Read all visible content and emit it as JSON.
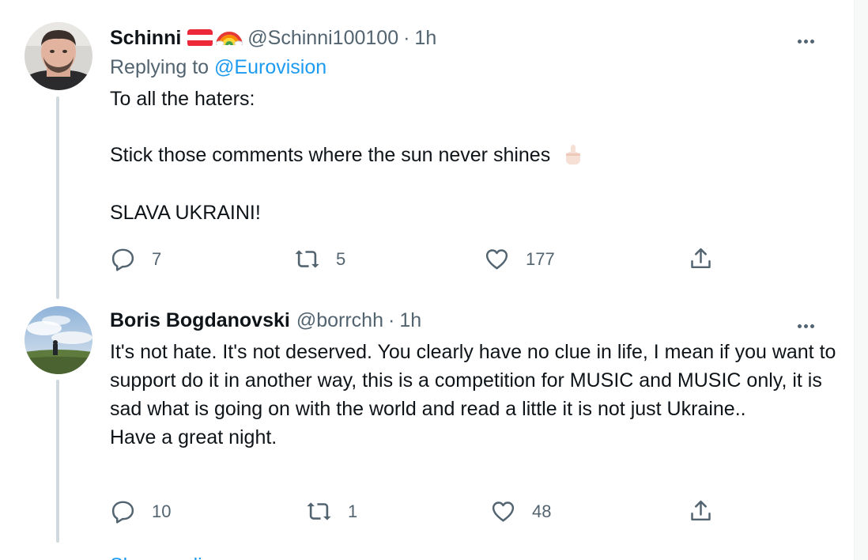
{
  "tweets": [
    {
      "display_name": "Schinni",
      "handle": "@Schinni100100",
      "time": "1h",
      "replying_prefix": "Replying to",
      "replying_to": "@Eurovision",
      "lines": [
        "To all the haters:",
        "Stick those comments where the sun never shines",
        "SLAVA UKRAINI!"
      ],
      "emoji": [
        "flag-austria",
        "rainbow",
        "middle-finger"
      ],
      "replies": "7",
      "retweets": "5",
      "likes": "177"
    },
    {
      "display_name": "Boris Bogdanovski",
      "handle": "@borrchh",
      "time": "1h",
      "body": "It's not hate. It's not deserved. You clearly have no clue in life, I mean if you want to support do it in another way, this is a competition for MUSIC and MUSIC only, it is sad what is going on with the world and read a little it is not just Ukraine..",
      "body_last": "Have a great night.",
      "replies": "10",
      "retweets": "1",
      "likes": "48"
    }
  ],
  "dot": "·",
  "show_replies": "Show replies",
  "colors": {
    "link": "#1d9bf0",
    "muted": "#536471",
    "thread_line": "#cfd9de"
  }
}
